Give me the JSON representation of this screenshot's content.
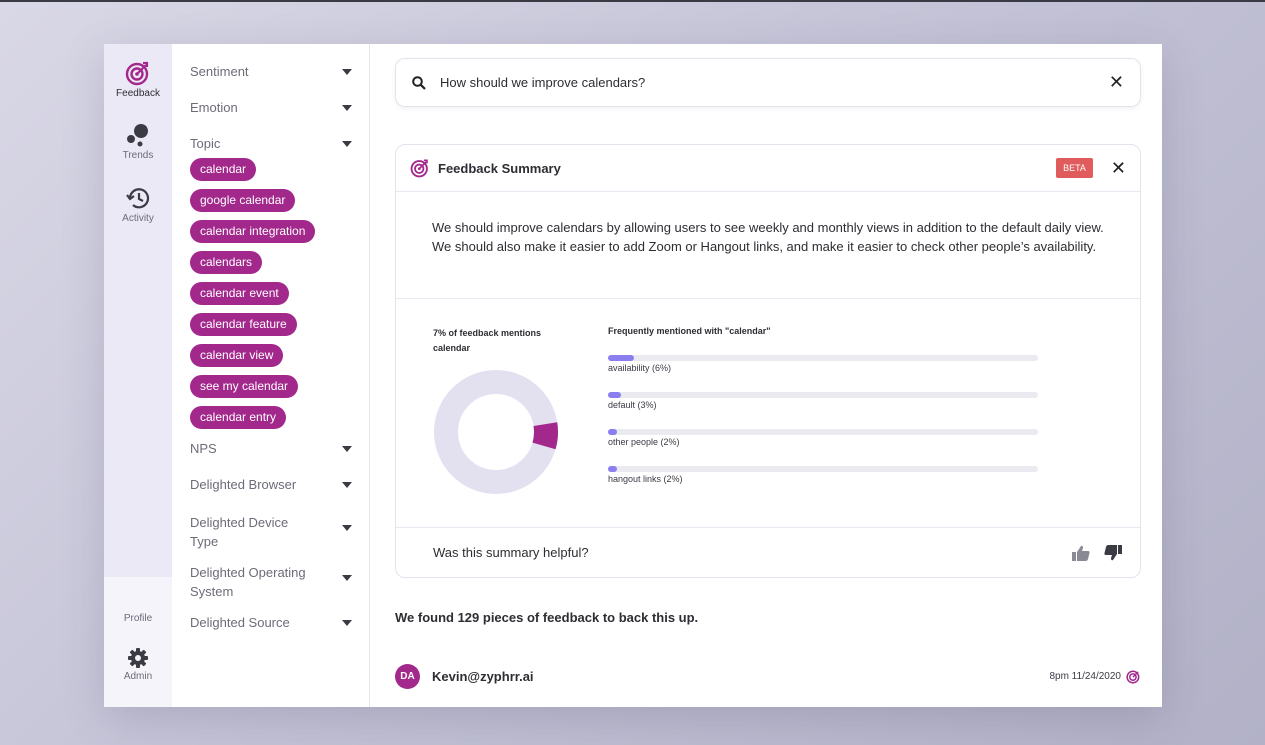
{
  "colors": {
    "accent": "#a3288c",
    "bar": "#8a7ef0",
    "beta": "#e05b5b",
    "rail": "#ece9f6"
  },
  "rail": {
    "items": [
      {
        "label": "Feedback",
        "icon": "target-icon"
      },
      {
        "label": "Trends",
        "icon": "bubbles-icon"
      },
      {
        "label": "Activity",
        "icon": "history-icon"
      }
    ],
    "profile_label": "Profile",
    "admin_label": "Admin"
  },
  "filters": {
    "sentiment": "Sentiment",
    "emotion": "Emotion",
    "topic": "Topic",
    "topic_chips": [
      "calendar",
      "google calendar",
      "calendar integration",
      "calendars",
      "calendar event",
      "calendar feature",
      "calendar view",
      "see my calendar",
      "calendar entry"
    ],
    "nps": "NPS",
    "browser": "Delighted Browser",
    "device": "Delighted Device Type",
    "os": "Delighted Operating System",
    "source": "Delighted Source"
  },
  "search": {
    "value": "How should we improve calendars?"
  },
  "summary": {
    "title": "Feedback Summary",
    "badge": "BETA",
    "text": "We should improve calendars by allowing users to see weekly and monthly views in addition to the default daily view. We should also make it easier to add Zoom or Hangout links, and make it easier to check other people’s availability.",
    "caption": "7% of feedback mentions calendar",
    "percent": 7,
    "freq_title": "Frequently mentioned with \"calendar\"",
    "freq": [
      {
        "label": "availability (6%)",
        "value": 6
      },
      {
        "label": "default (3%)",
        "value": 3
      },
      {
        "label": "other people (2%)",
        "value": 2
      },
      {
        "label": "hangout links (2%)",
        "value": 2
      }
    ],
    "helpful": "Was this summary helpful?"
  },
  "found": "We found 129 pieces of feedback to back this up.",
  "entry": {
    "initials": "DA",
    "name": "Kevin@zyphrr.ai",
    "time": "8pm 11/24/2020"
  }
}
